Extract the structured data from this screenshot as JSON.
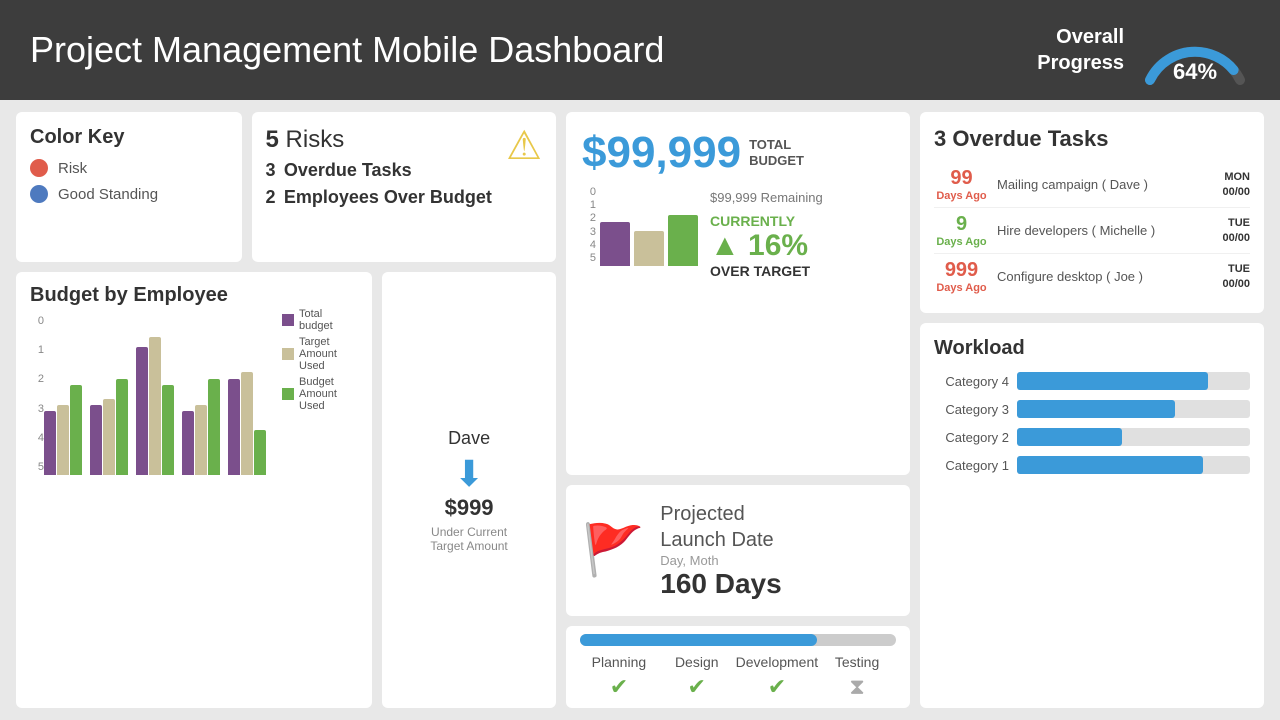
{
  "header": {
    "title": "Project Management Mobile Dashboard",
    "progress_label": "Overall\nProgress",
    "progress_pct": "64%",
    "progress_value": 64
  },
  "color_key": {
    "title": "Color Key",
    "items": [
      {
        "label": "Risk",
        "color": "#e05c4b"
      },
      {
        "label": "Good Standing",
        "color": "#4e7abf"
      }
    ]
  },
  "risks": {
    "count": "5",
    "label": "Risks",
    "overdue_count": "3",
    "overdue_label": "Overdue Tasks",
    "over_budget_count": "2",
    "over_budget_label": "Employees Over Budget"
  },
  "budget_by_employee": {
    "title": "Budget by Employee",
    "y_axis": [
      "5",
      "4",
      "3",
      "2",
      "1",
      "0"
    ],
    "legend": [
      {
        "label": "Total budget",
        "color": "#7b4f8c"
      },
      {
        "label": "Target Amount Used",
        "color": "#c9c09a"
      },
      {
        "label": "Budget Amount Used",
        "color": "#6ab04c"
      }
    ],
    "groups": [
      {
        "total": 2,
        "target": 2.2,
        "used": 2.8
      },
      {
        "total": 2.2,
        "target": 2.4,
        "used": 3.0
      },
      {
        "total": 4.0,
        "target": 4.3,
        "used": 2.8
      },
      {
        "total": 2.0,
        "target": 2.2,
        "used": 3.0
      },
      {
        "total": 3.0,
        "target": 3.2,
        "used": 1.4
      }
    ]
  },
  "dave": {
    "name": "Dave",
    "amount": "$999",
    "label": "Under Current\nTarget Amount"
  },
  "budget_overview": {
    "amount": "$99,999",
    "total_budget_label": "TOTAL\nBUDGET",
    "remaining": "$99,999 Remaining",
    "currently_label": "CURRENTLY",
    "arrow": "▲",
    "percentage": "16%",
    "over_target_label": "OVER TARGET",
    "mini_bars": [
      {
        "color": "#7b4f8c",
        "height": 70
      },
      {
        "color": "#c9c09a",
        "height": 55
      },
      {
        "color": "#6ab04c",
        "height": 80
      }
    ],
    "y_axis": [
      "5",
      "4",
      "3",
      "2",
      "1",
      "0"
    ]
  },
  "launch": {
    "title": "Projected\nLaunch Date",
    "sub": "Day, Moth",
    "days": "160 Days"
  },
  "phases": [
    {
      "name": "Planning",
      "icon": "✔",
      "done": true
    },
    {
      "name": "Design",
      "icon": "✔",
      "done": true
    },
    {
      "name": "Development",
      "icon": "✔",
      "done": true
    },
    {
      "name": "Testing",
      "icon": "⧗",
      "done": false
    }
  ],
  "progress_fill_pct": 75,
  "overdue": {
    "title_count": "3",
    "title_label": "Overdue Tasks",
    "tasks": [
      {
        "days": "99",
        "days_label": "Days Ago",
        "color": "#e05c4b",
        "task": "Mailing campaign ( Dave )",
        "day": "MON",
        "date": "00/00"
      },
      {
        "days": "9",
        "days_label": "Days Ago",
        "color": "#6ab04c",
        "task": "Hire developers ( Michelle )",
        "day": "TUE",
        "date": "00/00"
      },
      {
        "days": "999",
        "days_label": "Days Ago",
        "color": "#e05c4b",
        "task": "Configure desktop ( Joe )",
        "day": "TUE",
        "date": "00/00"
      }
    ]
  },
  "workload": {
    "title": "Workload",
    "categories": [
      {
        "label": "Category 4",
        "pct": 82
      },
      {
        "label": "Category 3",
        "pct": 68
      },
      {
        "label": "Category 2",
        "pct": 45
      },
      {
        "label": "Category 1",
        "pct": 80
      }
    ]
  }
}
